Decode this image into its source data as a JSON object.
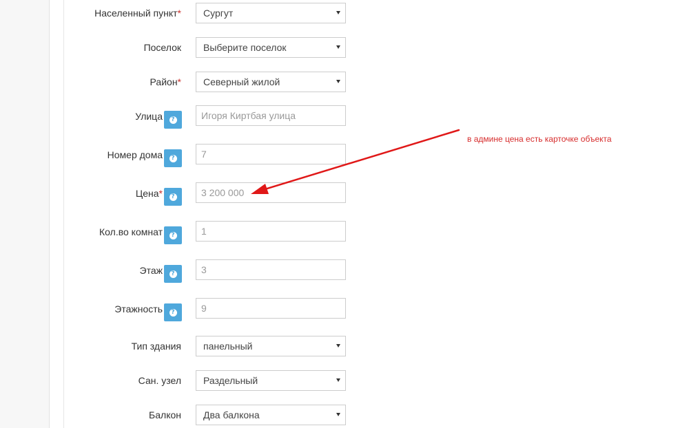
{
  "form": {
    "locality": {
      "label": "Населенный пункт",
      "required_mark": "*",
      "value": "Сургут",
      "caret": "chevron-down-icon"
    },
    "settlement": {
      "label": "Поселок",
      "value": "Выберите поселок",
      "caret": "chevron-down-icon"
    },
    "district": {
      "label": "Район",
      "required_mark": "*",
      "value": "Северный жилой",
      "caret": "chevron-down-icon"
    },
    "street": {
      "label": "Улица",
      "value": "Игоря Киртбая улица",
      "help_icon": "help-icon"
    },
    "house_number": {
      "label": "Номер дома",
      "value": "7",
      "help_icon": "help-icon"
    },
    "price": {
      "label": "Цена",
      "required_mark": "*",
      "value": "3 200 000",
      "help_icon": "help-icon"
    },
    "rooms": {
      "label": "Кол.во комнат",
      "value": "1",
      "help_icon": "help-icon"
    },
    "floor": {
      "label": "Этаж",
      "value": "3",
      "help_icon": "help-icon"
    },
    "floors_total": {
      "label": "Этажность",
      "value": "9",
      "help_icon": "help-icon"
    },
    "building_type": {
      "label": "Тип здания",
      "value": "панельный",
      "caret": "chevron-down-icon"
    },
    "bathroom": {
      "label": "Сан. узел",
      "value": "Раздельный",
      "caret": "chevron-down-icon"
    },
    "balcony": {
      "label": "Балкон",
      "value": "Два балкона",
      "caret": "chevron-down-icon"
    }
  },
  "annotation": {
    "text": "в админе цена есть карточке объекта",
    "color": "#d62b2b"
  },
  "colors": {
    "help_button": "#4fa8dc",
    "required": "#c9302c",
    "annotation_arrow": "#e01818"
  }
}
